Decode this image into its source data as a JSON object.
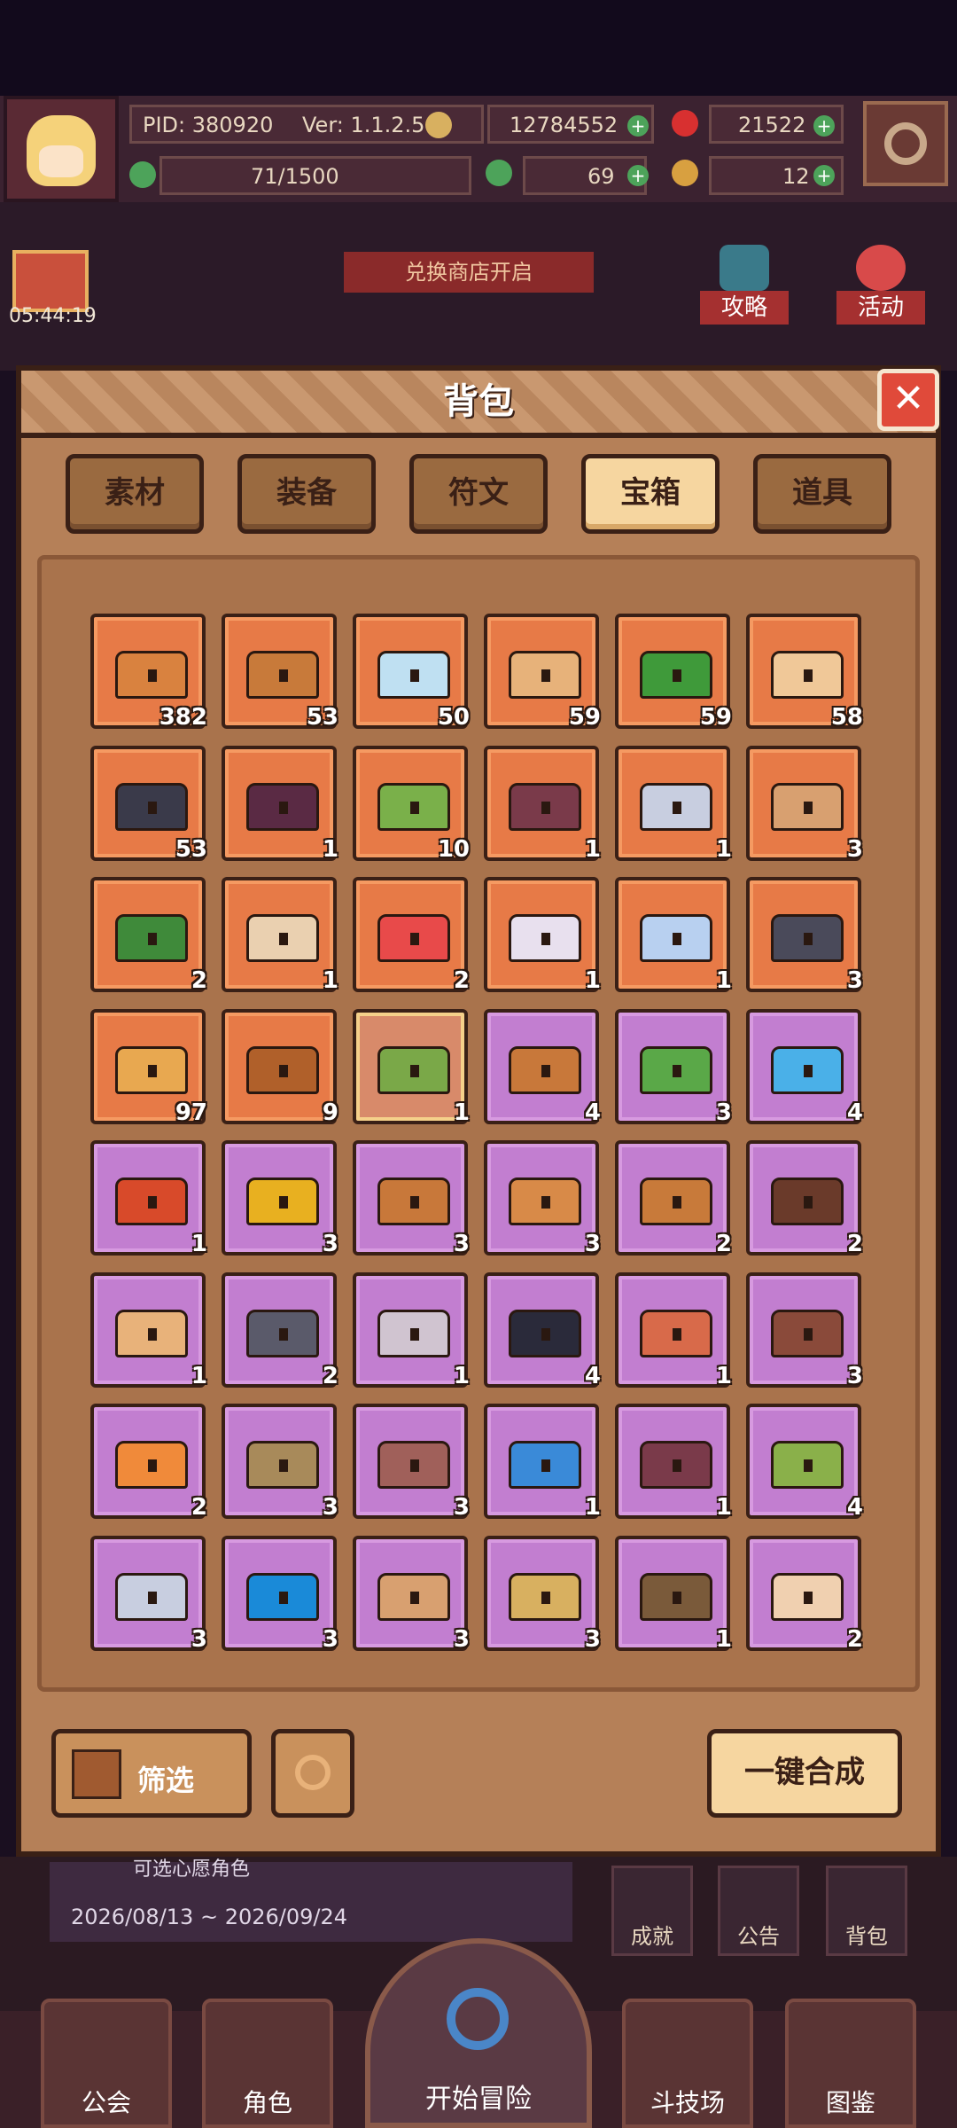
{
  "hud": {
    "pid": "PID: 380920",
    "version": "Ver: 1.1.2.5",
    "gold": "12784552",
    "gems": "21522",
    "exp": "71/1500",
    "clover": "69",
    "keys": "12"
  },
  "scene": {
    "timer": "05:44:19",
    "shop_banner": "兑换商店开启",
    "guide_label": "攻略",
    "activity_label": "活动"
  },
  "panel": {
    "title": "背包",
    "tabs": [
      "素材",
      "装备",
      "符文",
      "宝箱",
      "道具"
    ],
    "active_tab": "宝箱",
    "items": [
      {
        "count": "382",
        "tier": "orange",
        "color": "#d9823f"
      },
      {
        "count": "53",
        "tier": "orange",
        "color": "#c87a3a"
      },
      {
        "count": "50",
        "tier": "orange",
        "color": "#bfe0f2"
      },
      {
        "count": "59",
        "tier": "orange",
        "color": "#e7b27a"
      },
      {
        "count": "59",
        "tier": "orange",
        "color": "#3f9a3a"
      },
      {
        "count": "58",
        "tier": "orange",
        "color": "#f0c898"
      },
      {
        "count": "53",
        "tier": "orange",
        "color": "#3a3a4a"
      },
      {
        "count": "1",
        "tier": "orange",
        "color": "#5a2a44"
      },
      {
        "count": "10",
        "tier": "orange",
        "color": "#7ab04a"
      },
      {
        "count": "1",
        "tier": "orange",
        "color": "#7a3a4a"
      },
      {
        "count": "1",
        "tier": "orange",
        "color": "#c8cee0"
      },
      {
        "count": "3",
        "tier": "orange",
        "color": "#d8a070"
      },
      {
        "count": "2",
        "tier": "orange",
        "color": "#3f8a3a"
      },
      {
        "count": "1",
        "tier": "orange",
        "color": "#ead0b0"
      },
      {
        "count": "2",
        "tier": "orange",
        "color": "#e84a4a"
      },
      {
        "count": "1",
        "tier": "orange",
        "color": "#e8e0ee"
      },
      {
        "count": "1",
        "tier": "orange",
        "color": "#b8d0f0"
      },
      {
        "count": "3",
        "tier": "orange",
        "color": "#4a4a5a"
      },
      {
        "count": "97",
        "tier": "orange",
        "color": "#e8a850"
      },
      {
        "count": "9",
        "tier": "orange",
        "color": "#b0602a"
      },
      {
        "count": "1",
        "tier": "green",
        "color": "#7aa848"
      },
      {
        "count": "4",
        "tier": "purple",
        "color": "#c8783a"
      },
      {
        "count": "3",
        "tier": "purple",
        "color": "#5aa848"
      },
      {
        "count": "4",
        "tier": "purple",
        "color": "#4ab0e8"
      },
      {
        "count": "1",
        "tier": "purple",
        "color": "#d84a2a"
      },
      {
        "count": "3",
        "tier": "purple",
        "color": "#e8b020"
      },
      {
        "count": "3",
        "tier": "purple",
        "color": "#c8783a"
      },
      {
        "count": "3",
        "tier": "purple",
        "color": "#d88a48"
      },
      {
        "count": "2",
        "tier": "purple",
        "color": "#c87a3a"
      },
      {
        "count": "2",
        "tier": "purple",
        "color": "#6a3a2a"
      },
      {
        "count": "1",
        "tier": "purple",
        "color": "#e8b27a"
      },
      {
        "count": "2",
        "tier": "purple",
        "color": "#5a5a6a"
      },
      {
        "count": "1",
        "tier": "purple",
        "color": "#d0c4d0"
      },
      {
        "count": "4",
        "tier": "purple",
        "color": "#2a2a3a"
      },
      {
        "count": "1",
        "tier": "purple",
        "color": "#d86a4a"
      },
      {
        "count": "3",
        "tier": "purple",
        "color": "#8a4a3a"
      },
      {
        "count": "2",
        "tier": "purple",
        "color": "#f08a3a"
      },
      {
        "count": "3",
        "tier": "purple",
        "color": "#a88a5a"
      },
      {
        "count": "3",
        "tier": "purple",
        "color": "#a0605a"
      },
      {
        "count": "1",
        "tier": "purple",
        "color": "#3a8ad8"
      },
      {
        "count": "1",
        "tier": "purple",
        "color": "#7a3a4a"
      },
      {
        "count": "4",
        "tier": "purple",
        "color": "#8ab04a"
      },
      {
        "count": "3",
        "tier": "purple",
        "color": "#c8cee0"
      },
      {
        "count": "3",
        "tier": "purple",
        "color": "#1a8ad8"
      },
      {
        "count": "3",
        "tier": "purple",
        "color": "#d8a070"
      },
      {
        "count": "3",
        "tier": "purple",
        "color": "#d8b060"
      },
      {
        "count": "1",
        "tier": "purple",
        "color": "#7a5a3a"
      },
      {
        "count": "2",
        "tier": "purple",
        "color": "#f0d0b0"
      }
    ],
    "filter_label": "筛选",
    "merge_label": "一键合成"
  },
  "event": {
    "subtitle": "可选心愿角色",
    "date_range": "2026/08/13 ~ 2026/09/24"
  },
  "side_buttons": [
    "成就",
    "公告",
    "背包"
  ],
  "bottom_nav": {
    "guild": "公会",
    "role": "角色",
    "adventure": "开始冒险",
    "arena": "斗技场",
    "atlas": "图鉴"
  }
}
